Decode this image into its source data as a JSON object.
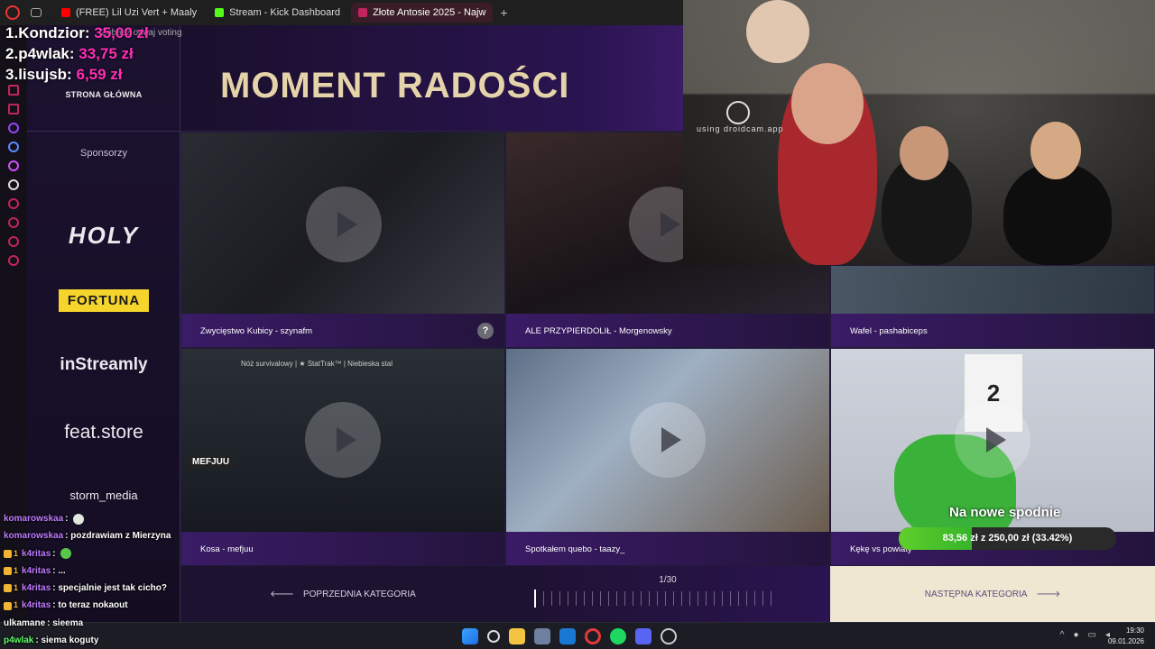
{
  "browser": {
    "tabs": [
      {
        "label": "(FREE) Lil Uzi Vert + Maaly",
        "active": false,
        "color": "#ff0000"
      },
      {
        "label": "Stream - Kick Dashboard",
        "active": false,
        "color": "#53fc18"
      },
      {
        "label": "Złote Antosie 2025 - Najw",
        "active": true,
        "color": "#c3245b"
      }
    ],
    "new_tab": "+"
  },
  "ranking": {
    "rows": [
      {
        "pos": "1.",
        "name": "Kondzior:",
        "amount": "35,00 zł"
      },
      {
        "pos": "2.",
        "name": "p4wlak:",
        "amount": "33,75 zł"
      },
      {
        "pos": "3.",
        "name": "lisujsb:",
        "amount": "6,59 zł"
      }
    ],
    "voting_note": "Zobacz oddaj voting"
  },
  "sidebar": {
    "home_link": "STRONA GŁÓWNA",
    "sponsors_label": "Sponsorzy",
    "logos": [
      "HOLY",
      "FORTUNA",
      "inStreamly",
      "feat.store",
      "storm_media"
    ]
  },
  "hero": {
    "title": "MOMENT RADOŚCI"
  },
  "tiles": [
    {
      "caption": "Zwycięstwo Kubicy - szynafm",
      "help": "?"
    },
    {
      "caption": "ALE PRZYPIERDOLIŁ - Morgenowsky"
    },
    {
      "caption": "Wafel - pashabiceps"
    },
    {
      "caption": "Kosa - mefjuu",
      "overlay_label": "MEFJUU",
      "inner_title": "Nóż survivalowy | ★ StatTrak™ | Niebieska stal"
    },
    {
      "caption": "Spotkałem quebo - taazy_"
    },
    {
      "caption": "Kękę vs powiaty",
      "inner_number": "2"
    }
  ],
  "donation": {
    "title": "Na nowe spodnie",
    "progress_text": "83,56 zł z 250,00 zł (33.42%)",
    "progress": 0.3342
  },
  "category_nav": {
    "prev": "POPRZEDNIA KATEGORIA",
    "counter": "1/30",
    "next": "NASTĘPNA KATEGORIA",
    "prev_arrow": "🡐",
    "next_arrow": "🡒"
  },
  "webcam": {
    "watermark": "using droidcam.app"
  },
  "chat": [
    {
      "user": "komarowskaa",
      "message": ":",
      "badge": false,
      "emote": "white"
    },
    {
      "user": "komarowskaa",
      "message": ": pozdrawiam z Mierzyna",
      "badge": false
    },
    {
      "user": "k4ritas",
      "message": ":",
      "badge": true,
      "badge_num": "1",
      "emote": "green"
    },
    {
      "user": "k4ritas",
      "message": ": ...",
      "badge": true,
      "badge_num": "1"
    },
    {
      "user": "k4ritas",
      "message": ": specjalnie jest tak cicho?",
      "badge": true,
      "badge_num": "1"
    },
    {
      "user": "k4ritas",
      "message": ": to teraz nokaout",
      "badge": true,
      "badge_num": "1"
    },
    {
      "user": "ulkamane",
      "message": ": sieema",
      "badge": false,
      "white_name": true
    },
    {
      "user": "p4wlak",
      "message": ": siema koguty",
      "badge": false,
      "green_name": true
    }
  ],
  "taskbar": {
    "time": "19:30",
    "date": "09.01.2026"
  }
}
